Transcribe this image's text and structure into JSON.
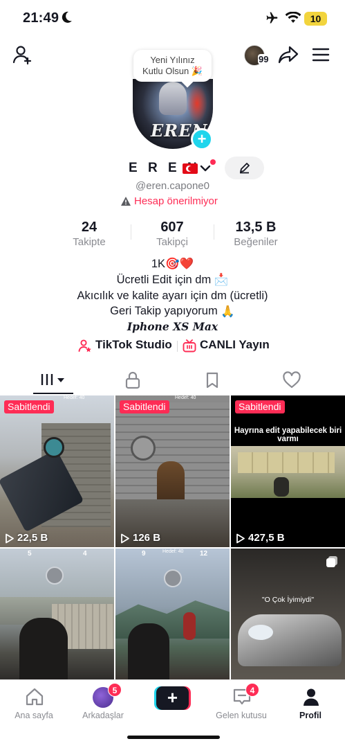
{
  "status_bar": {
    "time": "21:49",
    "battery": "10"
  },
  "top_nav": {
    "follower_badge": "99"
  },
  "bubble": {
    "line1": "Yeni Yılınız",
    "line2": "Kutlu Olsun 🎉"
  },
  "avatar": {
    "logo_text": "EREN"
  },
  "profile": {
    "name": "E R E N",
    "handle": "@eren.capone0",
    "warning": "Hesap önerilmiyor"
  },
  "stats": [
    {
      "value": "24",
      "label": "Takipte"
    },
    {
      "value": "607",
      "label": "Takipçi"
    },
    {
      "value": "13,5 B",
      "label": "Beğeniler"
    }
  ],
  "bio": {
    "line1": "1K",
    "line2": "Ücretli Edit için dm",
    "line3": "Akıcılık ve kalite ayarı için dm (ücretli)",
    "line4": "Geri Takip yapıyorum",
    "line5": "Iphone XS Max"
  },
  "links": {
    "studio": "TikTok Studio",
    "live": "CANLI Yayın"
  },
  "videos": [
    {
      "pinned": "Sabitlendi",
      "views": "22,5 B",
      "top_hud": "Hedef: 40"
    },
    {
      "pinned": "Sabitlendi",
      "views": "126 B",
      "top_hud": "Hedef: 40"
    },
    {
      "pinned": "Sabitlendi",
      "views": "427,5 B",
      "caption": "Hayrına edit yapabilecek biri varmı"
    },
    {
      "hud_left": "5",
      "hud_right": "4"
    },
    {
      "hud_left": "9",
      "hud_mid": "Hedef: 40",
      "hud_right": "12"
    },
    {
      "caption": "\"O Çok İyimiydi\""
    }
  ],
  "bottom_nav": {
    "home": "Ana sayfa",
    "friends": "Arkadaşlar",
    "friends_badge": "5",
    "inbox": "Gelen kutusu",
    "inbox_badge": "4",
    "profile": "Profil",
    "create": "+"
  },
  "colors": {
    "accent_red": "#fe2c55",
    "accent_cyan": "#20d5ec",
    "text_dark": "#161823",
    "text_gray": "#8a8b91"
  }
}
